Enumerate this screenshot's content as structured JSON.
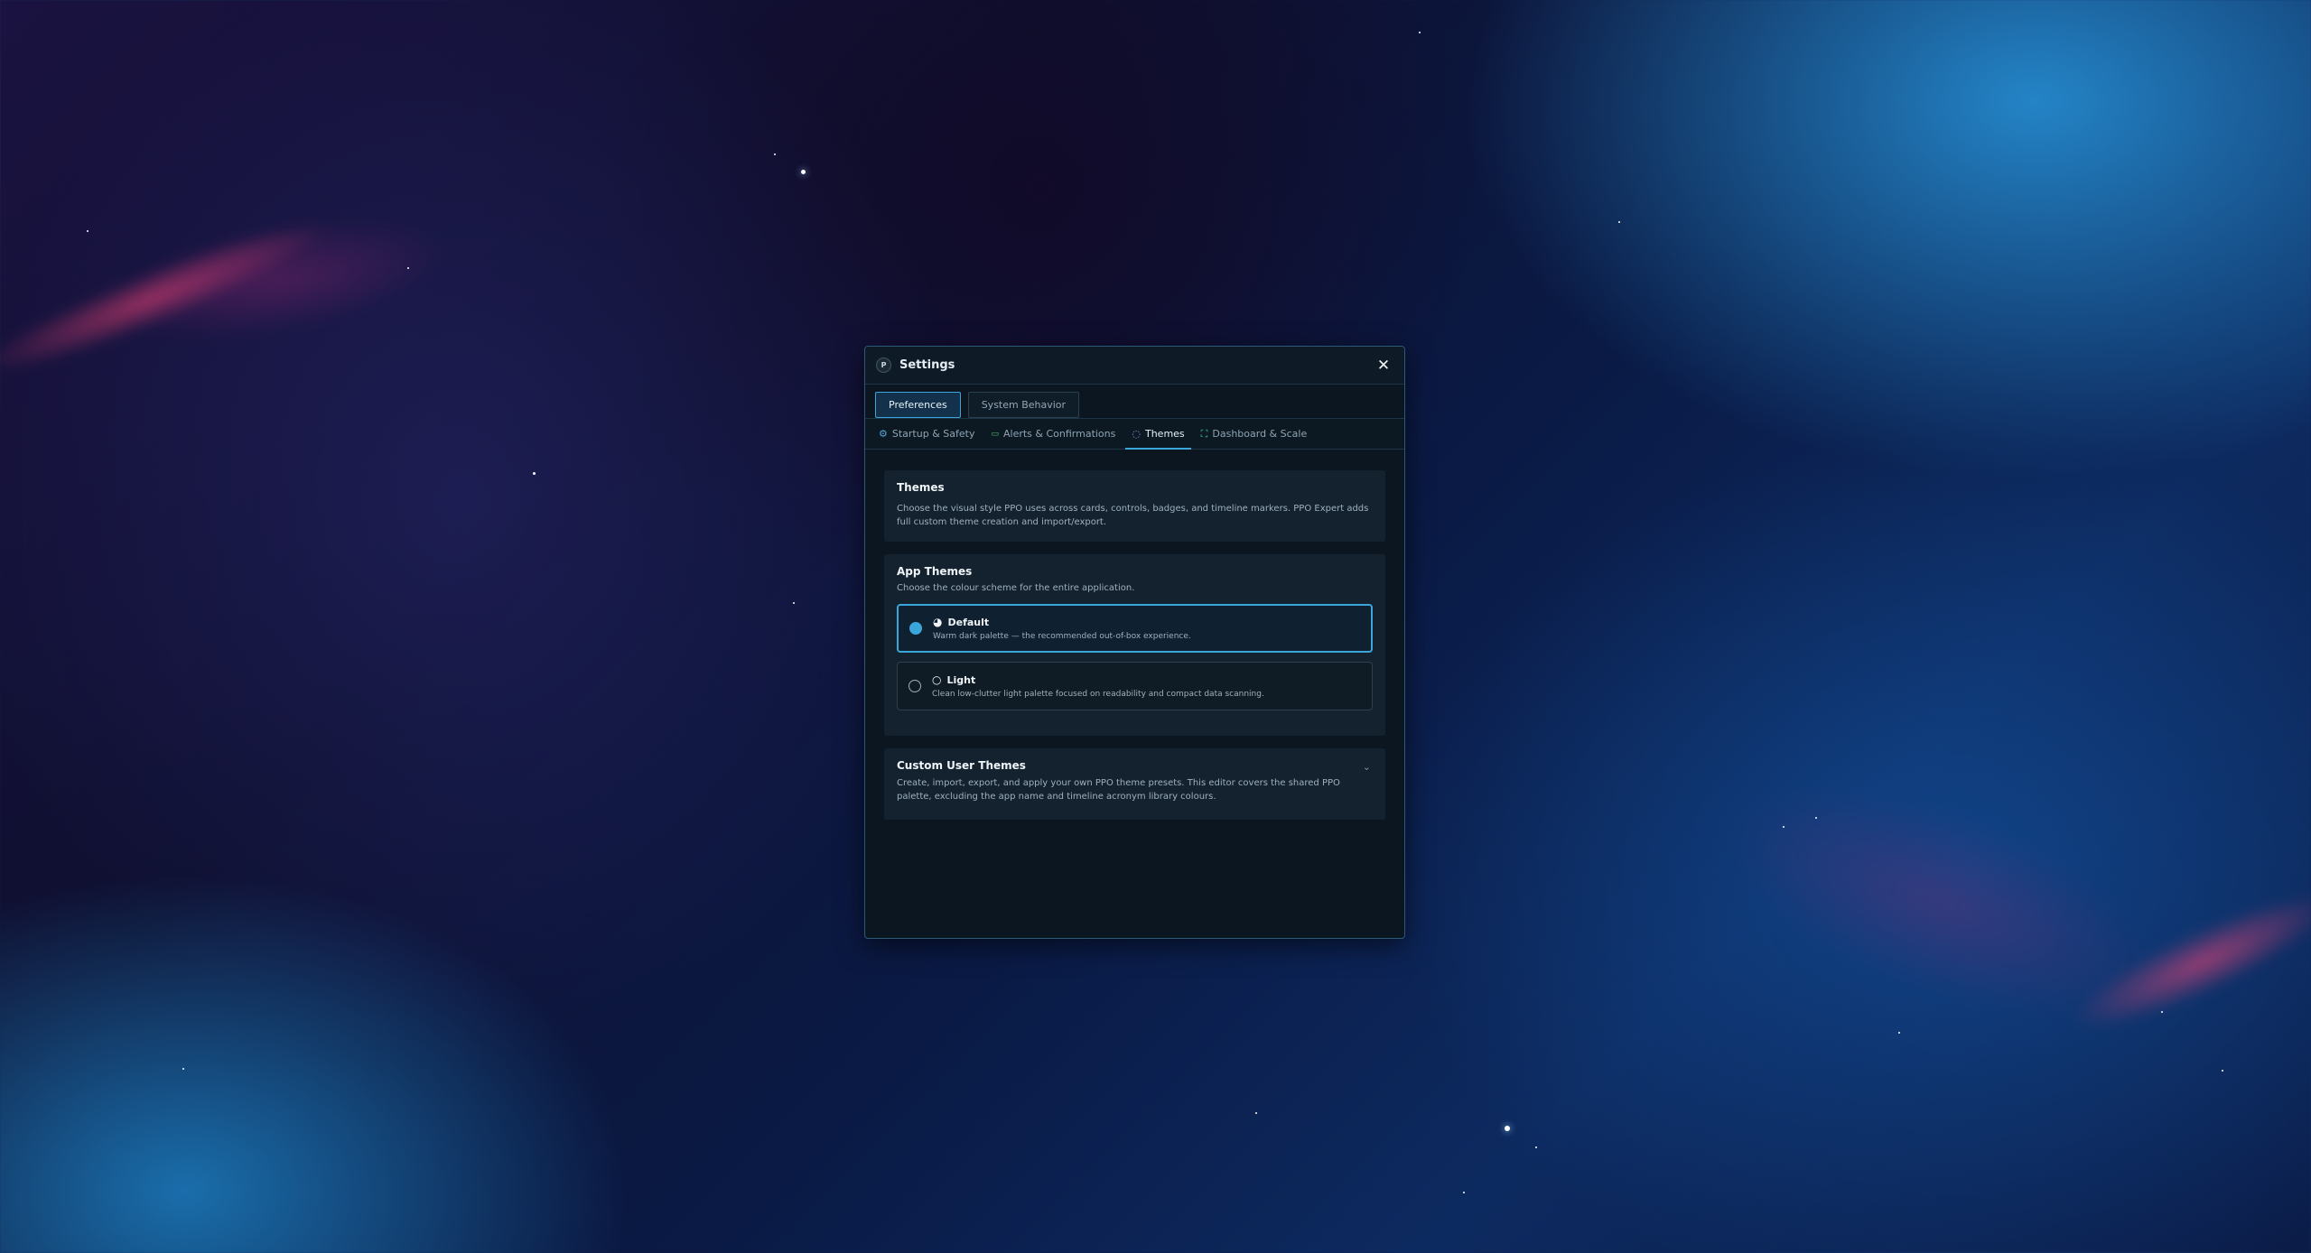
{
  "dialog": {
    "title": "Settings",
    "logo_letter": "P",
    "close_glyph": "✕"
  },
  "top_tabs": [
    {
      "label": "Preferences",
      "active": true
    },
    {
      "label": "System Behavior",
      "active": false
    }
  ],
  "sub_tabs": [
    {
      "label": "Startup & Safety",
      "icon": "gear-icon",
      "glyph": "⚙",
      "active": false
    },
    {
      "label": "Alerts & Confirmations",
      "icon": "chat-bubble-icon",
      "glyph": "▭",
      "active": false
    },
    {
      "label": "Themes",
      "icon": "palette-icon",
      "glyph": "◌",
      "active": true
    },
    {
      "label": "Dashboard & Scale",
      "icon": "expand-icon",
      "glyph": "⛶",
      "active": false
    }
  ],
  "themes_card": {
    "title": "Themes",
    "description": "Choose the visual style PPO uses across cards, controls, badges, and timeline markers. PPO Expert adds full custom theme creation and import/export."
  },
  "app_themes": {
    "title": "App Themes",
    "description": "Choose the colour scheme for the entire application.",
    "options": [
      {
        "name": "Default",
        "description": "Warm dark palette — the recommended out-of-box experience.",
        "icon": "half-moon-icon",
        "glyph": "◕",
        "selected": true
      },
      {
        "name": "Light",
        "description": "Clean low-clutter light palette focused on readability and compact data scanning.",
        "icon": "sun-outline-icon",
        "glyph": "○",
        "selected": false
      }
    ]
  },
  "custom_themes": {
    "title": "Custom User Themes",
    "description": "Create, import, export, and apply your own PPO theme presets. This editor covers the shared PPO palette, excluding the app name and timeline acronym library colours.",
    "chevron_glyph": "⌄"
  },
  "colors": {
    "accent": "#3aa6da",
    "dialog_bg": "#0b1620",
    "card_bg": "#13222e"
  }
}
